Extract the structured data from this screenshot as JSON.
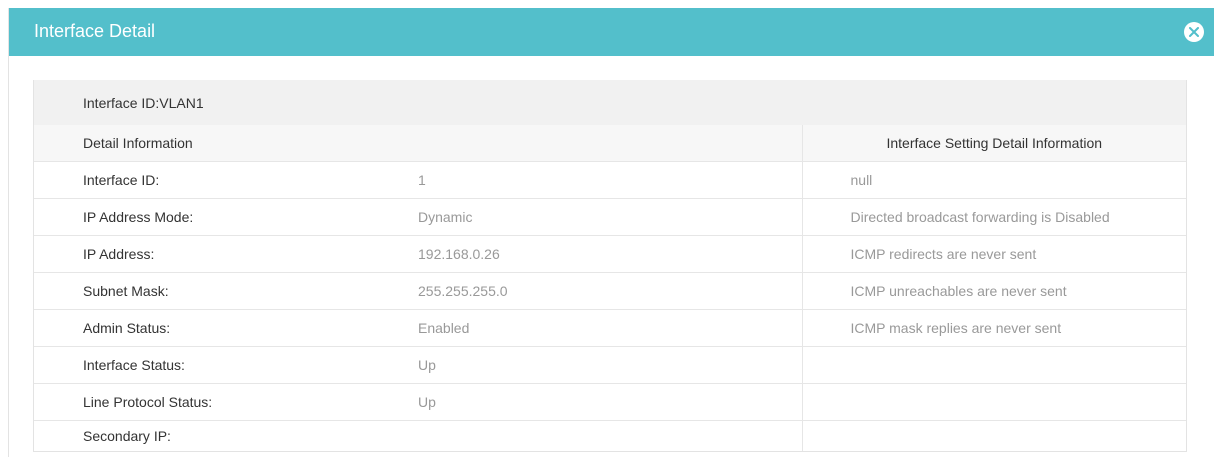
{
  "dialog": {
    "title": "Interface Detail",
    "close_icon": "close-circle-icon"
  },
  "panel": {
    "interface_header": "Interface ID:VLAN1",
    "left_column_header": "Detail Information",
    "right_column_header": "Interface Setting Detail Information",
    "rows": [
      {
        "label": "Interface ID:",
        "value": "1",
        "info": "null"
      },
      {
        "label": "IP Address Mode:",
        "value": "Dynamic",
        "info": "Directed broadcast forwarding is Disabled"
      },
      {
        "label": "IP Address:",
        "value": "192.168.0.26",
        "info": "ICMP redirects are never sent"
      },
      {
        "label": "Subnet Mask:",
        "value": "255.255.255.0",
        "info": "ICMP unreachables are never sent"
      },
      {
        "label": "Admin Status:",
        "value": "Enabled",
        "info": "ICMP mask replies are never sent"
      },
      {
        "label": "Interface Status:",
        "value": "Up",
        "info": ""
      },
      {
        "label": "Line Protocol Status:",
        "value": "Up",
        "info": ""
      },
      {
        "label": "Secondary IP:",
        "value": "",
        "info": ""
      }
    ]
  },
  "colors": {
    "title_bar": "#53bfcb",
    "header_bg": "#f1f1f1",
    "value_text": "#999999"
  }
}
